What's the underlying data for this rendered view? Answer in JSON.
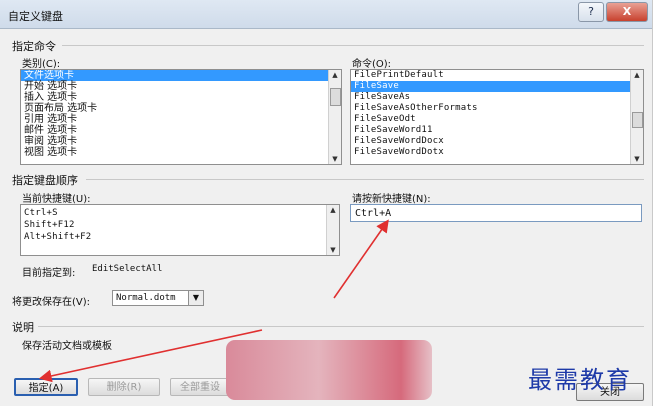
{
  "window": {
    "title": "自定义键盘",
    "help_label": "?",
    "close_label": "X"
  },
  "specify_command": {
    "section_label": "指定命令",
    "categories_label": "类别(C):",
    "categories": [
      "文件选项卡",
      "开始 选项卡",
      "插入 选项卡",
      "页面布局 选项卡",
      "引用 选项卡",
      "邮件 选项卡",
      "审阅 选项卡",
      "视图 选项卡"
    ],
    "commands_label": "命令(O):",
    "commands": [
      "FilePrintDefault",
      "FileSave",
      "FileSaveAs",
      "FileSaveAsOtherFormats",
      "FileSaveOdt",
      "FileSaveWord11",
      "FileSaveWordDocx",
      "FileSaveWordDotx"
    ]
  },
  "key_sequence": {
    "section_label": "指定键盘顺序",
    "current_keys_label": "当前快捷键(U):",
    "current_keys": [
      "Ctrl+S",
      "Shift+F12",
      "Alt+Shift+F2"
    ],
    "new_key_label": "请按新快捷键(N):",
    "new_key_value": "Ctrl+A",
    "assigned_to_label": "目前指定到:",
    "assigned_to_value": "EditSelectAll",
    "save_in_label": "将更改保存在(V):",
    "save_in_value": "Normal.dotm"
  },
  "description": {
    "section_label": "说明",
    "text": "保存活动文档或模板"
  },
  "buttons": {
    "assign": "指定(A)",
    "remove": "删除(R)",
    "reset_all": "全部重设",
    "close": "关闭"
  },
  "watermark_text": "最需教育",
  "colors": {
    "selection": "#3399ff",
    "annotation_arrow": "#e03030",
    "watermark": "#1e3aa8"
  }
}
